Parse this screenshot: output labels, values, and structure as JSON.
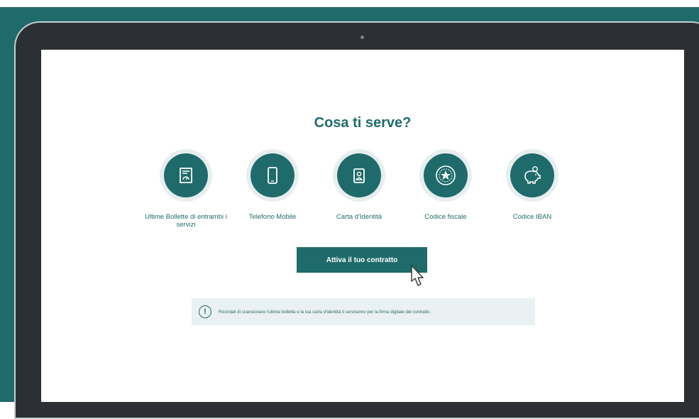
{
  "page": {
    "title": "Cosa ti serve?"
  },
  "items": [
    {
      "label": "Ultime Bollette di entrambi i servizi",
      "icon": "bill-document-icon"
    },
    {
      "label": "Telefono Mobile",
      "icon": "mobile-phone-icon"
    },
    {
      "label": "Carta d'Identità",
      "icon": "id-card-icon"
    },
    {
      "label": "Codice fiscale",
      "icon": "italian-emblem-icon"
    },
    {
      "label": "Codice IBAN",
      "icon": "piggy-bank-icon"
    }
  ],
  "cta": {
    "label": "Attiva il tuo contratto"
  },
  "info": {
    "text": "Ricordati di scansionare l'ultima bolletta e la tua carta d'identità ti serviranno per la firma digitale del contratto."
  },
  "colors": {
    "brand": "#1f6b6b",
    "light": "#e7eef0"
  }
}
